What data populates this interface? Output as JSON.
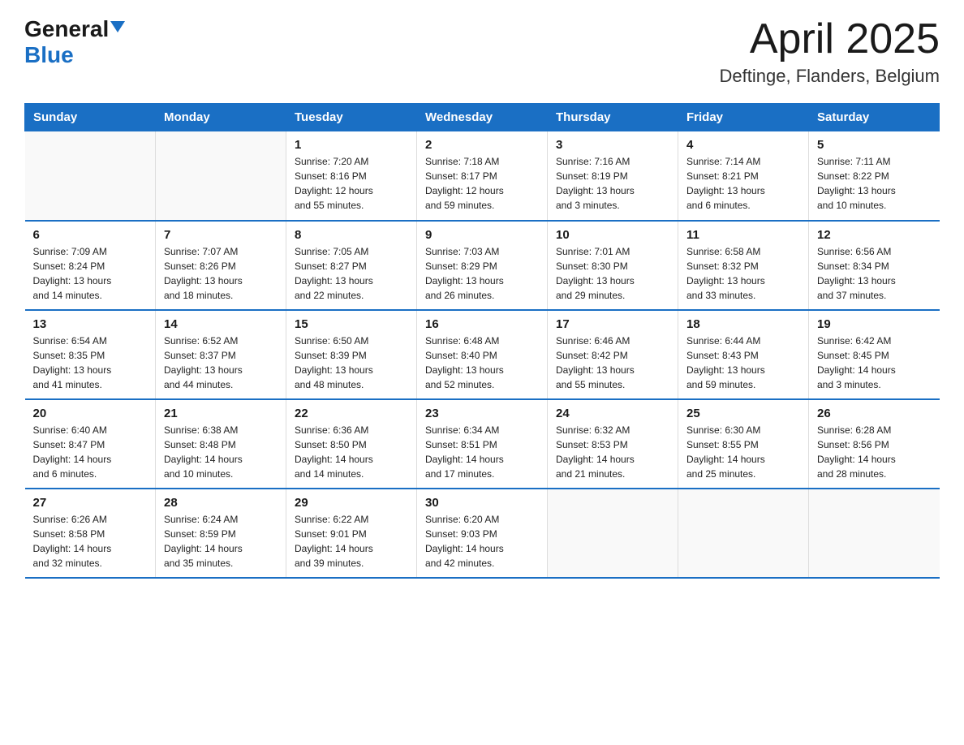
{
  "header": {
    "logo_general": "General",
    "logo_blue": "Blue",
    "month_title": "April 2025",
    "location": "Deftinge, Flanders, Belgium"
  },
  "days_of_week": [
    "Sunday",
    "Monday",
    "Tuesday",
    "Wednesday",
    "Thursday",
    "Friday",
    "Saturday"
  ],
  "weeks": [
    [
      {
        "day": "",
        "info": ""
      },
      {
        "day": "",
        "info": ""
      },
      {
        "day": "1",
        "info": "Sunrise: 7:20 AM\nSunset: 8:16 PM\nDaylight: 12 hours\nand 55 minutes."
      },
      {
        "day": "2",
        "info": "Sunrise: 7:18 AM\nSunset: 8:17 PM\nDaylight: 12 hours\nand 59 minutes."
      },
      {
        "day": "3",
        "info": "Sunrise: 7:16 AM\nSunset: 8:19 PM\nDaylight: 13 hours\nand 3 minutes."
      },
      {
        "day": "4",
        "info": "Sunrise: 7:14 AM\nSunset: 8:21 PM\nDaylight: 13 hours\nand 6 minutes."
      },
      {
        "day": "5",
        "info": "Sunrise: 7:11 AM\nSunset: 8:22 PM\nDaylight: 13 hours\nand 10 minutes."
      }
    ],
    [
      {
        "day": "6",
        "info": "Sunrise: 7:09 AM\nSunset: 8:24 PM\nDaylight: 13 hours\nand 14 minutes."
      },
      {
        "day": "7",
        "info": "Sunrise: 7:07 AM\nSunset: 8:26 PM\nDaylight: 13 hours\nand 18 minutes."
      },
      {
        "day": "8",
        "info": "Sunrise: 7:05 AM\nSunset: 8:27 PM\nDaylight: 13 hours\nand 22 minutes."
      },
      {
        "day": "9",
        "info": "Sunrise: 7:03 AM\nSunset: 8:29 PM\nDaylight: 13 hours\nand 26 minutes."
      },
      {
        "day": "10",
        "info": "Sunrise: 7:01 AM\nSunset: 8:30 PM\nDaylight: 13 hours\nand 29 minutes."
      },
      {
        "day": "11",
        "info": "Sunrise: 6:58 AM\nSunset: 8:32 PM\nDaylight: 13 hours\nand 33 minutes."
      },
      {
        "day": "12",
        "info": "Sunrise: 6:56 AM\nSunset: 8:34 PM\nDaylight: 13 hours\nand 37 minutes."
      }
    ],
    [
      {
        "day": "13",
        "info": "Sunrise: 6:54 AM\nSunset: 8:35 PM\nDaylight: 13 hours\nand 41 minutes."
      },
      {
        "day": "14",
        "info": "Sunrise: 6:52 AM\nSunset: 8:37 PM\nDaylight: 13 hours\nand 44 minutes."
      },
      {
        "day": "15",
        "info": "Sunrise: 6:50 AM\nSunset: 8:39 PM\nDaylight: 13 hours\nand 48 minutes."
      },
      {
        "day": "16",
        "info": "Sunrise: 6:48 AM\nSunset: 8:40 PM\nDaylight: 13 hours\nand 52 minutes."
      },
      {
        "day": "17",
        "info": "Sunrise: 6:46 AM\nSunset: 8:42 PM\nDaylight: 13 hours\nand 55 minutes."
      },
      {
        "day": "18",
        "info": "Sunrise: 6:44 AM\nSunset: 8:43 PM\nDaylight: 13 hours\nand 59 minutes."
      },
      {
        "day": "19",
        "info": "Sunrise: 6:42 AM\nSunset: 8:45 PM\nDaylight: 14 hours\nand 3 minutes."
      }
    ],
    [
      {
        "day": "20",
        "info": "Sunrise: 6:40 AM\nSunset: 8:47 PM\nDaylight: 14 hours\nand 6 minutes."
      },
      {
        "day": "21",
        "info": "Sunrise: 6:38 AM\nSunset: 8:48 PM\nDaylight: 14 hours\nand 10 minutes."
      },
      {
        "day": "22",
        "info": "Sunrise: 6:36 AM\nSunset: 8:50 PM\nDaylight: 14 hours\nand 14 minutes."
      },
      {
        "day": "23",
        "info": "Sunrise: 6:34 AM\nSunset: 8:51 PM\nDaylight: 14 hours\nand 17 minutes."
      },
      {
        "day": "24",
        "info": "Sunrise: 6:32 AM\nSunset: 8:53 PM\nDaylight: 14 hours\nand 21 minutes."
      },
      {
        "day": "25",
        "info": "Sunrise: 6:30 AM\nSunset: 8:55 PM\nDaylight: 14 hours\nand 25 minutes."
      },
      {
        "day": "26",
        "info": "Sunrise: 6:28 AM\nSunset: 8:56 PM\nDaylight: 14 hours\nand 28 minutes."
      }
    ],
    [
      {
        "day": "27",
        "info": "Sunrise: 6:26 AM\nSunset: 8:58 PM\nDaylight: 14 hours\nand 32 minutes."
      },
      {
        "day": "28",
        "info": "Sunrise: 6:24 AM\nSunset: 8:59 PM\nDaylight: 14 hours\nand 35 minutes."
      },
      {
        "day": "29",
        "info": "Sunrise: 6:22 AM\nSunset: 9:01 PM\nDaylight: 14 hours\nand 39 minutes."
      },
      {
        "day": "30",
        "info": "Sunrise: 6:20 AM\nSunset: 9:03 PM\nDaylight: 14 hours\nand 42 minutes."
      },
      {
        "day": "",
        "info": ""
      },
      {
        "day": "",
        "info": ""
      },
      {
        "day": "",
        "info": ""
      }
    ]
  ]
}
